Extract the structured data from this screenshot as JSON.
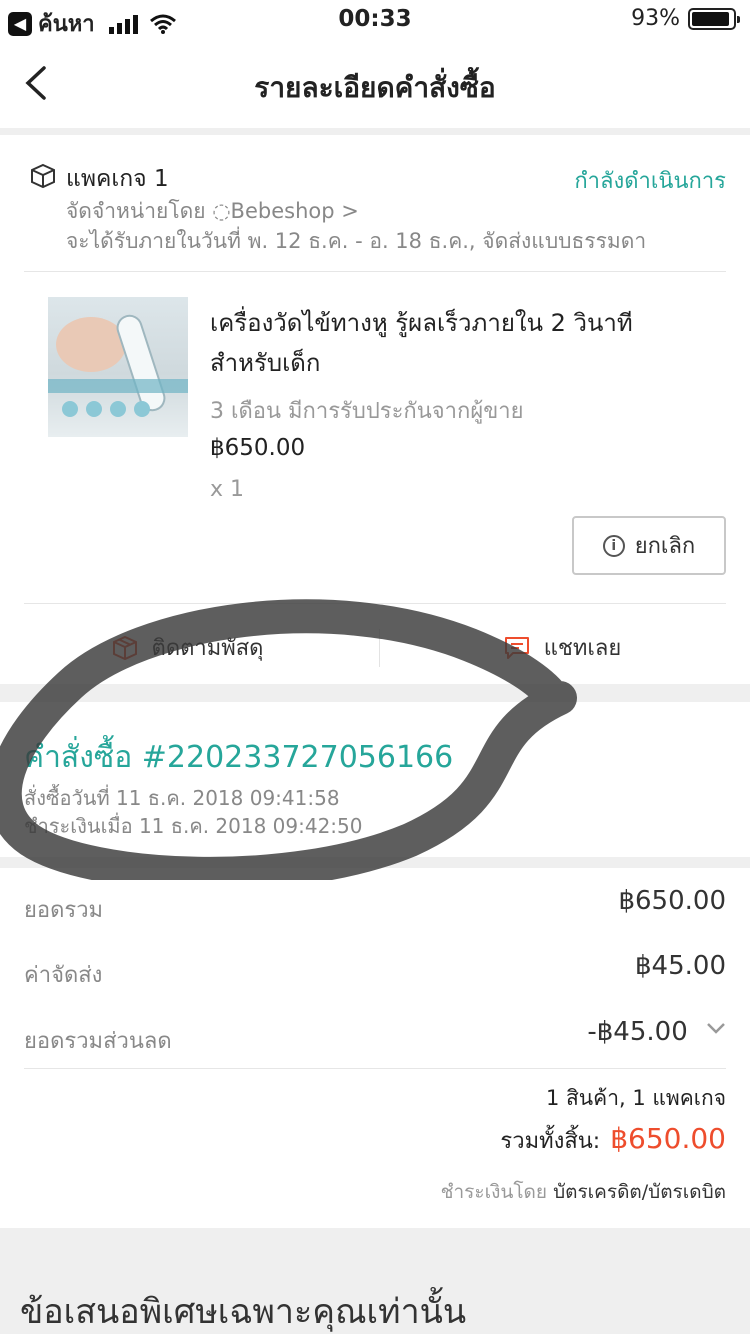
{
  "status_bar": {
    "back_app": "ค้นหา",
    "time": "00:33",
    "battery": "93%",
    "battery_level": 0.93
  },
  "header": {
    "title": "รายละเอียดคำสั่งซื้อ"
  },
  "package": {
    "label": "แพคเกจ 1",
    "status": "กำลังดำเนินการ",
    "seller": "จัดจำหน่ายโดย ◌Bebeshop >",
    "eta": "จะได้รับภายในวันที่ พ. 12 ธ.ค. - อ. 18 ธ.ค., จัดส่งแบบธรรมดา",
    "product": {
      "name": "เครื่องวัดไข้ทางหู รู้ผลเร็วภายใน 2 วินาที สำหรับเด็ก",
      "variant": "3 เดือน มีการรับประกันจากผู้ขาย",
      "price": "฿650.00",
      "qty": "x 1"
    },
    "cancel_label": "ยกเลิก",
    "track_label": "ติดตามพัสดุ",
    "chat_label": "แชทเลย"
  },
  "order": {
    "number": "คำสั่งซื้อ #220233727056166",
    "ordered_at": "สั่งซื้อวันที่ 11 ธ.ค. 2018  09:41:58",
    "paid_at": "ชำระเงินเมื่อ 11 ธ.ค. 2018  09:42:50"
  },
  "summary": {
    "subtotal_label": "ยอดรวม",
    "subtotal": "฿650.00",
    "shipping_label": "ค่าจัดส่ง",
    "shipping": "฿45.00",
    "discount_label": "ยอดรวมส่วนลด",
    "discount": "-฿45.00",
    "count": "1 สินค้า, 1 แพคเกจ",
    "total_label": "รวมทั้งสิ้น:",
    "total": "฿650.00",
    "pay_prefix": "ชำระเงินโดย",
    "pay_method": "บัตรเครดิต/บัตรเดบิต"
  },
  "offers": {
    "title": "ข้อเสนอพิเศษเฉพาะคุณเท่านั้น"
  },
  "colors": {
    "accent": "#26a69a",
    "price": "#ee4d2d"
  }
}
